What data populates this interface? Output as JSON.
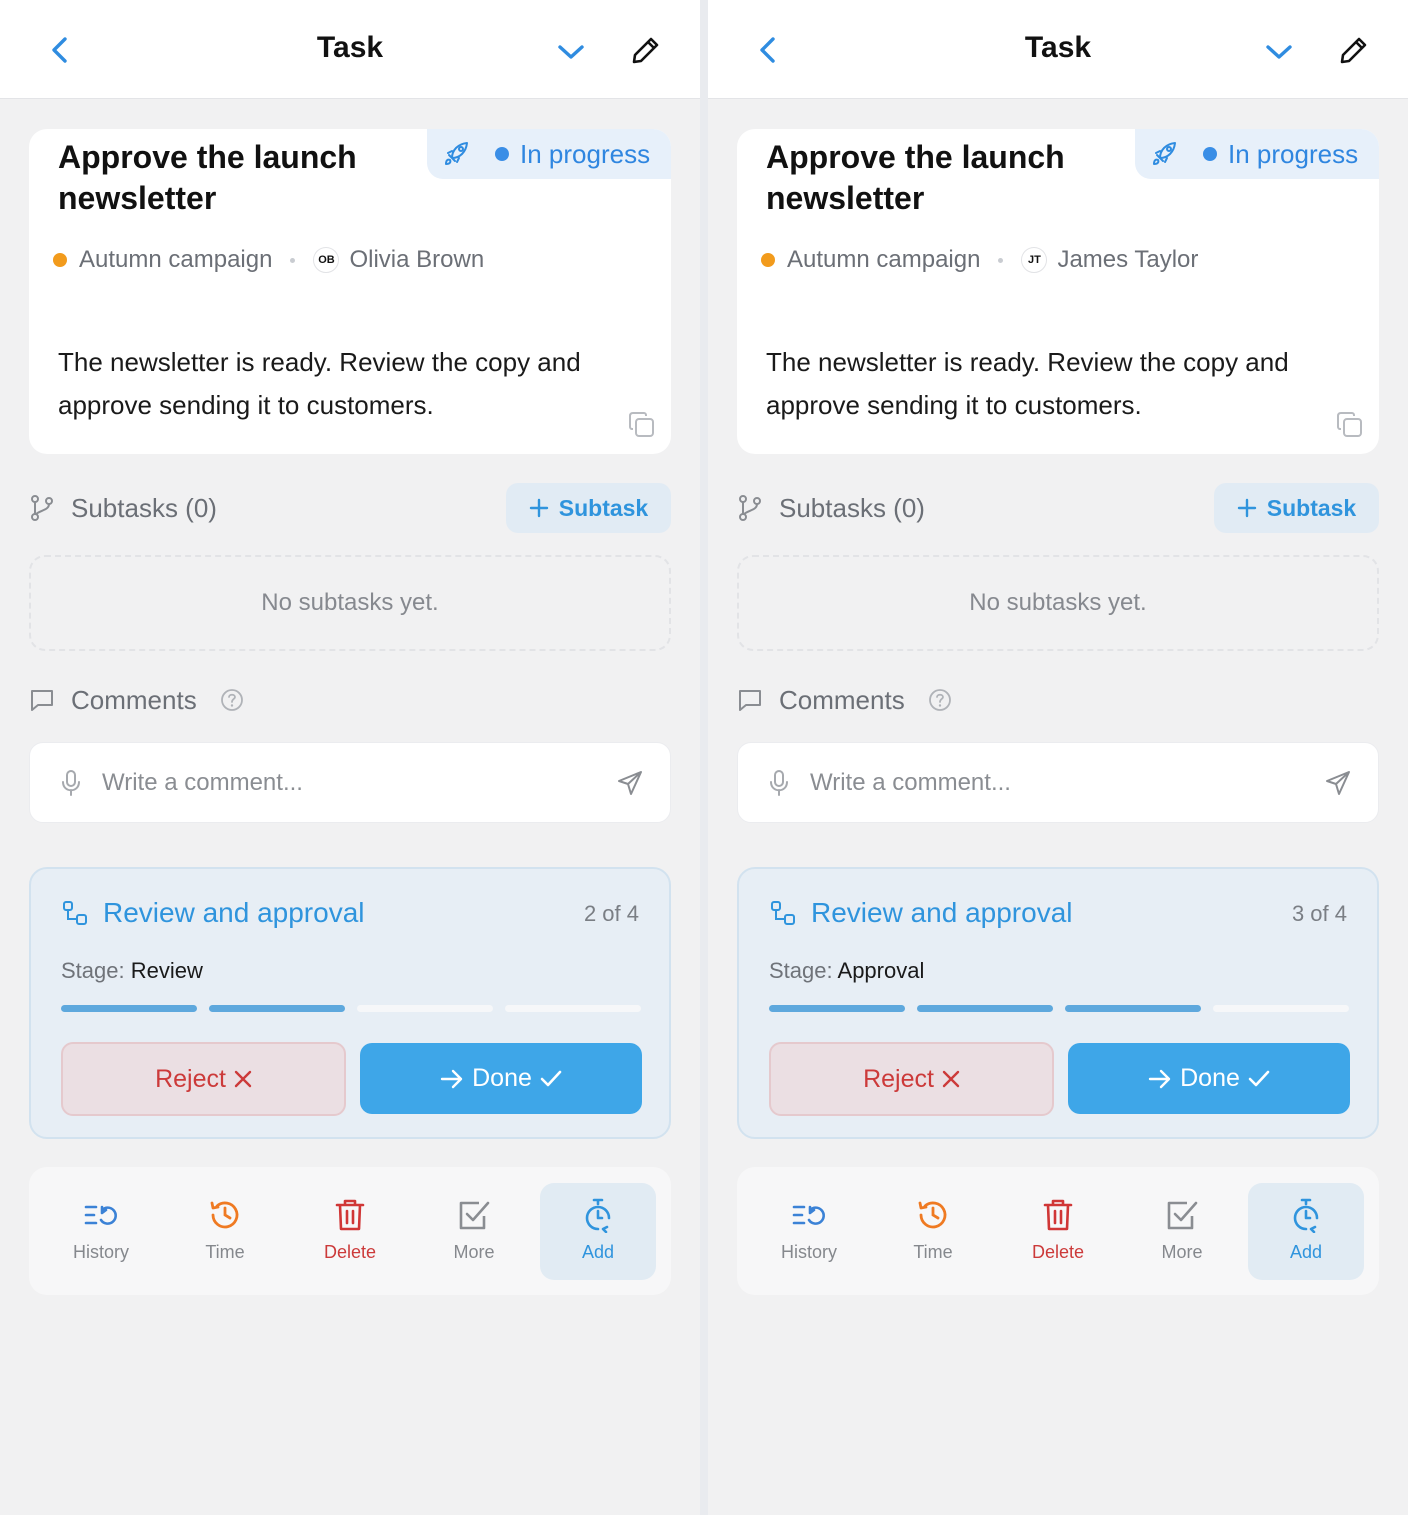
{
  "colors": {
    "accent": "#2f94dd",
    "status": "#3a8ee6",
    "project": "#f29b1c",
    "danger": "#cc3a3a",
    "primary_button": "#3ea6e8",
    "history_icon": "#3b82d6",
    "time_icon": "#ef7a22"
  },
  "icons": {
    "back": "chevron-left-icon",
    "collapse": "chevron-down-icon",
    "edit": "pencil-icon",
    "status": "rocket-icon",
    "copy": "copy-icon",
    "subtasks": "branch-icon",
    "comments": "speech-bubble-icon",
    "help": "question-circle-icon",
    "mic": "microphone-icon",
    "send": "send-icon",
    "workflow": "workflow-icon",
    "history": "history-list-icon",
    "time": "clock-history-icon",
    "delete": "trash-icon",
    "more": "checkbox-icon",
    "add": "timer-add-icon"
  },
  "panels": [
    {
      "header": {
        "title": "Task"
      },
      "task": {
        "title": "Approve the launch newsletter",
        "status": "In progress",
        "project": "Autumn campaign",
        "assignee_initials": "OB",
        "assignee": "Olivia Brown",
        "description": "The newsletter is ready. Review the copy and approve sending it to customers."
      },
      "subtasks": {
        "label": "Subtasks (0)",
        "add_label": "Subtask",
        "empty": "No subtasks yet."
      },
      "comments": {
        "label": "Comments",
        "placeholder": "Write a comment..."
      },
      "workflow": {
        "title": "Review and approval",
        "step": "2 of 4",
        "stage_key": "Stage:",
        "stage_value": "Review",
        "completed": 2,
        "total": 4,
        "reject_label": "Reject",
        "done_label": "Done"
      },
      "toolbar": {
        "history": "History",
        "time": "Time",
        "delete": "Delete",
        "more": "More",
        "add": "Add"
      }
    },
    {
      "header": {
        "title": "Task"
      },
      "task": {
        "title": "Approve the launch newsletter",
        "status": "In progress",
        "project": "Autumn campaign",
        "assignee_initials": "JT",
        "assignee": "James Taylor",
        "description": "The newsletter is ready. Review the copy and approve sending it to customers."
      },
      "subtasks": {
        "label": "Subtasks (0)",
        "add_label": "Subtask",
        "empty": "No subtasks yet."
      },
      "comments": {
        "label": "Comments",
        "placeholder": "Write a comment..."
      },
      "workflow": {
        "title": "Review and approval",
        "step": "3 of 4",
        "stage_key": "Stage:",
        "stage_value": "Approval",
        "completed": 3,
        "total": 4,
        "reject_label": "Reject",
        "done_label": "Done"
      },
      "toolbar": {
        "history": "History",
        "time": "Time",
        "delete": "Delete",
        "more": "More",
        "add": "Add"
      }
    }
  ]
}
